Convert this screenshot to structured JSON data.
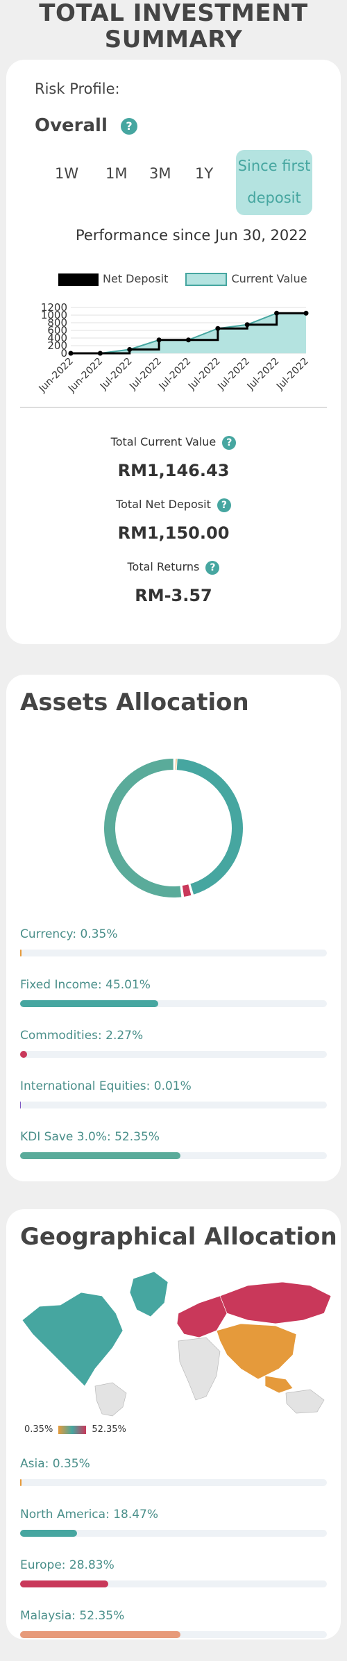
{
  "header": {
    "title_line1": "TOTAL INVESTMENT",
    "title_line2": "SUMMARY"
  },
  "summary": {
    "risk_profile_label": "Risk Profile:",
    "overall_label": "Overall",
    "help_glyph": "?",
    "periods": [
      "1W",
      "1M",
      "3M",
      "1Y"
    ],
    "active_period_line1": "Since first",
    "active_period_line2": "deposit",
    "performance_text": "Performance since Jun 30, 2022",
    "stats": {
      "current_value_label": "Total Current Value",
      "current_value": "RM1,146.43",
      "net_deposit_label": "Total Net Deposit",
      "net_deposit": "RM1,150.00",
      "returns_label": "Total Returns",
      "returns": "RM-3.57"
    }
  },
  "chart_data": {
    "type": "area",
    "x": [
      "Jun-2022",
      "Jun-2022",
      "Jul-2022",
      "Jul-2022",
      "Jul-2022",
      "Jul-2022",
      "Jul-2022",
      "Jul-2022",
      "Jul-2022"
    ],
    "series": [
      {
        "name": "Net Deposit",
        "values": [
          0,
          0,
          100,
          350,
          350,
          650,
          750,
          1050,
          1050
        ]
      },
      {
        "name": "Current Value",
        "values": [
          0,
          0,
          100,
          350,
          350,
          650,
          750,
          1050,
          1050
        ]
      }
    ],
    "y_ticks": [
      0,
      200,
      400,
      600,
      800,
      1000,
      1200
    ],
    "ylim": [
      0,
      1200
    ],
    "legend_position": "top",
    "colors": {
      "net_deposit": "#000000",
      "current_value_fill": "#b4e3e0",
      "current_value_line": "#46a6a0"
    }
  },
  "assets": {
    "title": "Assets Allocation",
    "items": [
      {
        "label": "Currency: 0.35%",
        "percent": 0.35,
        "color": "#e59a3b"
      },
      {
        "label": "Fixed Income: 45.01%",
        "percent": 45.01,
        "color": "#46a6a0"
      },
      {
        "label": "Commodities: 2.27%",
        "percent": 2.27,
        "color": "#c9385a"
      },
      {
        "label": "International Equities: 0.01%",
        "percent": 0.01,
        "color": "#7e57c2"
      },
      {
        "label": "KDI Save 3.0%: 52.35%",
        "percent": 52.35,
        "color": "#5aab9a"
      }
    ]
  },
  "geo": {
    "title": "Geographical Allocation",
    "scale_min": "0.35%",
    "scale_max": "52.35%",
    "items": [
      {
        "label": "Asia: 0.35%",
        "percent": 0.35,
        "color": "#e59a3b"
      },
      {
        "label": "North America: 18.47%",
        "percent": 18.47,
        "color": "#46a6a0"
      },
      {
        "label": "Europe: 28.83%",
        "percent": 28.83,
        "color": "#c9385a"
      },
      {
        "label": "Malaysia: 52.35%",
        "percent": 52.35,
        "color": "#e79a7a"
      }
    ]
  }
}
